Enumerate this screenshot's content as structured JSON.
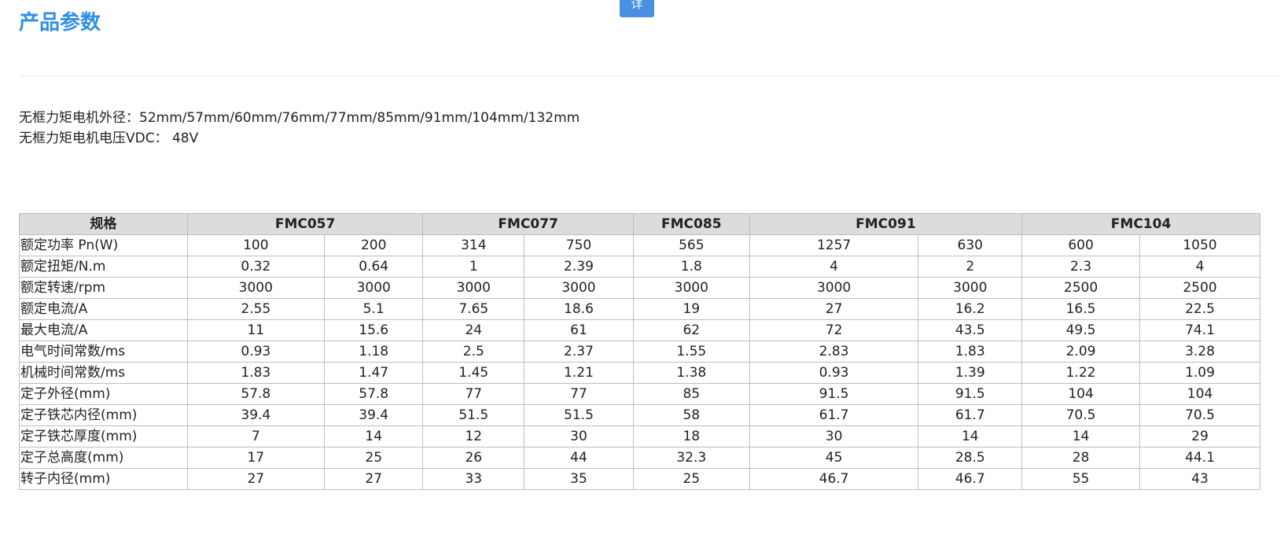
{
  "top_button": {
    "label": "详"
  },
  "page_title": "产品参数",
  "specs": {
    "line1": "无框力矩电机外径：52mm/57mm/60mm/76mm/77mm/85mm/91mm/104mm/132mm",
    "line2": "无框力矩电机电压VDC： 48V"
  },
  "table": {
    "header": {
      "label": "规格",
      "groups": [
        {
          "name": "FMC057",
          "span": 2
        },
        {
          "name": "FMC077",
          "span": 2
        },
        {
          "name": "FMC085",
          "span": 1
        },
        {
          "name": "FMC091",
          "span": 2
        },
        {
          "name": "FMC104",
          "span": 2
        }
      ]
    },
    "rows": [
      {
        "label": "额定功率 Pn(W)",
        "cells": [
          "100",
          "200",
          "314",
          "750",
          "565",
          "1257",
          "630",
          "600",
          "1050"
        ]
      },
      {
        "label": "额定扭矩/N.m",
        "cells": [
          "0.32",
          "0.64",
          "1",
          "2.39",
          "1.8",
          "4",
          "2",
          "2.3",
          "4"
        ]
      },
      {
        "label": "额定转速/rpm",
        "cells": [
          "3000",
          "3000",
          "3000",
          "3000",
          "3000",
          "3000",
          "3000",
          "2500",
          "2500"
        ]
      },
      {
        "label": "额定电流/A",
        "cells": [
          "2.55",
          "5.1",
          "7.65",
          "18.6",
          "19",
          "27",
          "16.2",
          "16.5",
          "22.5"
        ]
      },
      {
        "label": "最大电流/A",
        "cells": [
          "11",
          "15.6",
          "24",
          "61",
          "62",
          "72",
          "43.5",
          "49.5",
          "74.1"
        ]
      },
      {
        "label": "电气时间常数/ms",
        "cells": [
          "0.93",
          "1.18",
          "2.5",
          "2.37",
          "1.55",
          "2.83",
          "1.83",
          "2.09",
          "3.28"
        ]
      },
      {
        "label": "机械时间常数/ms",
        "cells": [
          "1.83",
          "1.47",
          "1.45",
          "1.21",
          "1.38",
          "0.93",
          "1.39",
          "1.22",
          "1.09"
        ]
      },
      {
        "label": "定子外径(mm)",
        "cells": [
          "57.8",
          "57.8",
          "77",
          "77",
          "85",
          "91.5",
          "91.5",
          "104",
          "104"
        ]
      },
      {
        "label": "定子铁芯内径(mm)",
        "cells": [
          "39.4",
          "39.4",
          "51.5",
          "51.5",
          "58",
          "61.7",
          "61.7",
          "70.5",
          "70.5"
        ]
      },
      {
        "label": "定子铁芯厚度(mm)",
        "cells": [
          "7",
          "14",
          "12",
          "30",
          "18",
          "30",
          "14",
          "14",
          "29"
        ]
      },
      {
        "label": "定子总高度(mm)",
        "cells": [
          "17",
          "25",
          "26",
          "44",
          "32.3",
          "45",
          "28.5",
          "28",
          "44.1"
        ]
      },
      {
        "label": "转子内径(mm)",
        "cells": [
          "27",
          "27",
          "33",
          "35",
          "25",
          "46.7",
          "46.7",
          "55",
          "43"
        ]
      }
    ]
  }
}
